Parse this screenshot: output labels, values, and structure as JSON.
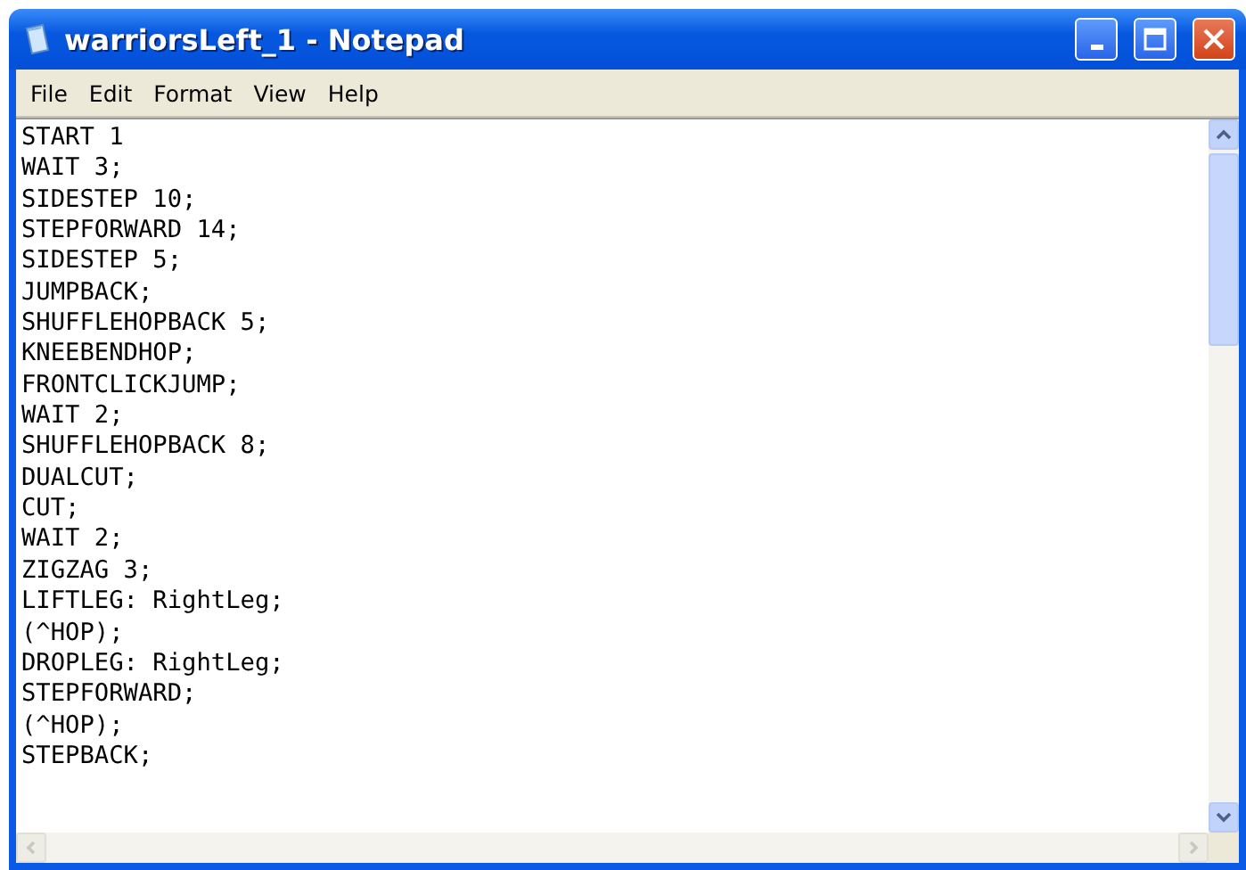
{
  "window": {
    "title": "warriorsLeft_1 - Notepad"
  },
  "menu": [
    "File",
    "Edit",
    "Format",
    "View",
    "Help"
  ],
  "lines": [
    "START 1",
    "WAIT 3;",
    "SIDESTEP 10;",
    "STEPFORWARD 14;",
    "SIDESTEP 5;",
    "JUMPBACK;",
    "SHUFFLEHOPBACK 5;",
    "KNEEBENDHOP;",
    "FRONTCLICKJUMP;",
    "WAIT 2;",
    "SHUFFLEHOPBACK 8;",
    "DUALCUT;",
    "CUT;",
    "WAIT 2;",
    "ZIGZAG 3;",
    "LIFTLEG: RightLeg;",
    "(^HOP);",
    "DROPLEG: RightLeg;",
    "STEPFORWARD;",
    "(^HOP);",
    "STEPBACK;"
  ]
}
